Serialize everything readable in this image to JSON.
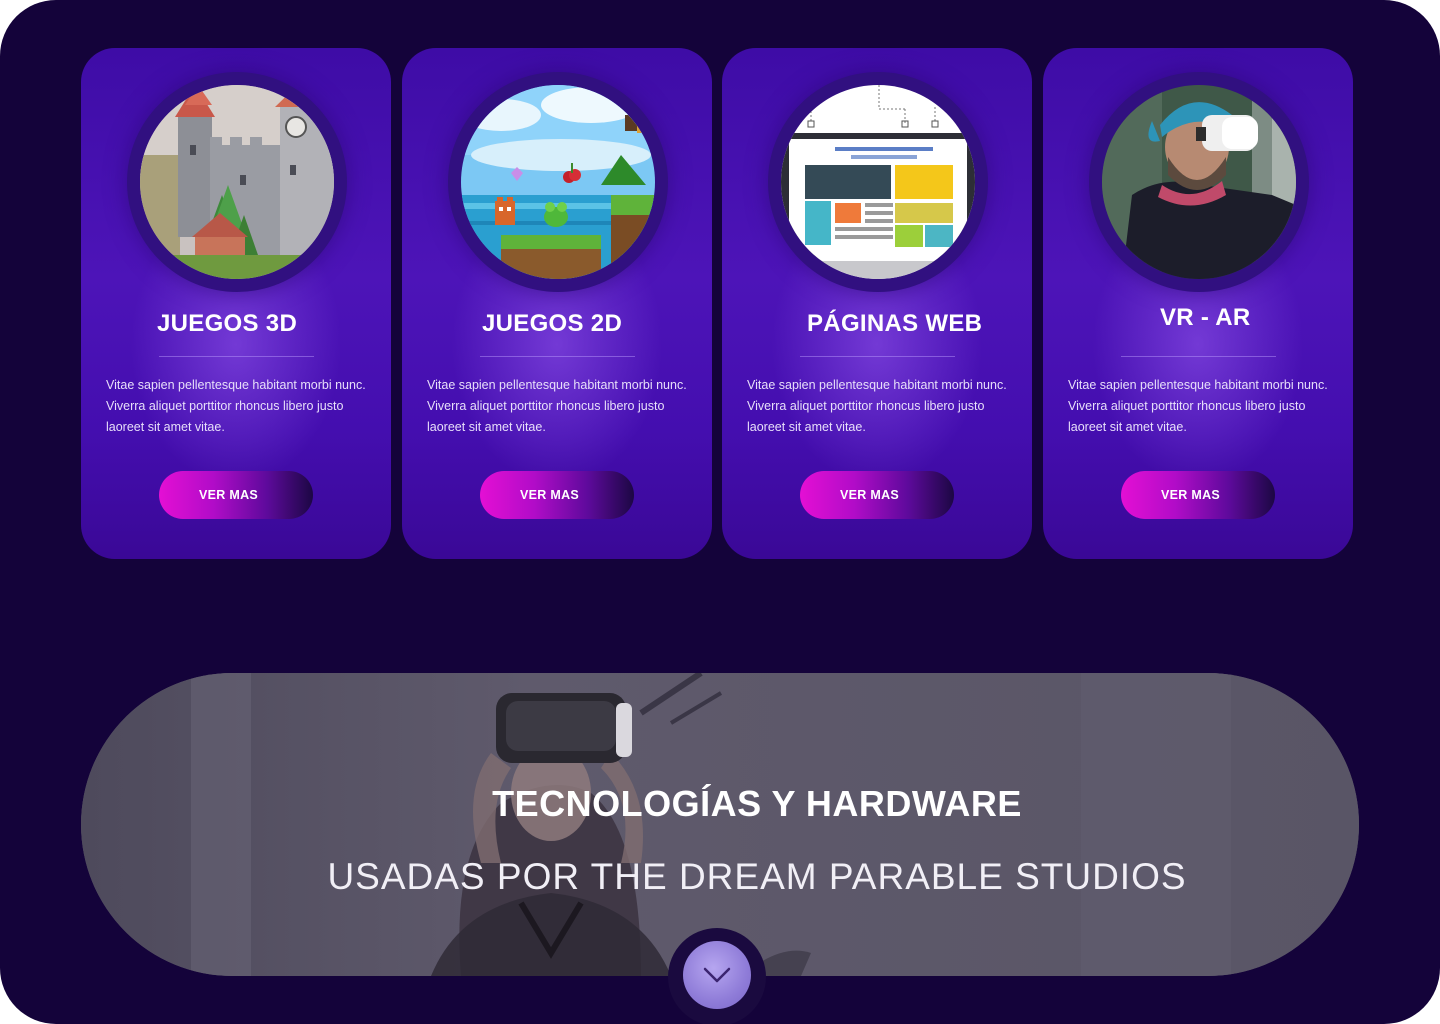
{
  "cards": [
    {
      "title": "JUEGOS 3D",
      "text": "Vitae sapien pellentesque habitant morbi nunc. Viverra aliquet  porttitor rhoncus libero justo laoreet sit amet vitae.",
      "button": "VER MAS",
      "image": "castle-3d-illustration"
    },
    {
      "title": "JUEGOS 2D",
      "text": "Vitae sapien pellentesque habitant morbi nunc. Viverra aliquet  porttitor rhoncus libero justo laoreet sit amet vitae.",
      "button": "VER MAS",
      "image": "pixel-platformer-illustration"
    },
    {
      "title": "PÁGINAS WEB",
      "text": "Vitae sapien pellentesque habitant morbi nunc. Viverra aliquet  porttitor rhoncus libero justo laoreet sit amet vitae.",
      "button": "VER MAS",
      "image": "website-wireframe-illustration"
    },
    {
      "title": "VR - AR",
      "text": "Vitae sapien pellentesque habitant morbi nunc. Viverra aliquet  porttitor rhoncus libero justo laoreet sit amet vitae.",
      "button": "VER MAS",
      "image": "man-with-vr-headset-photo"
    }
  ],
  "banner": {
    "title": "TECNOLOGÍAS Y HARDWARE",
    "subtitle": "USADAS  POR THE DREAM PARABLE STUDIOS",
    "image": "woman-with-vr-headset-photo"
  },
  "scroll_button": {
    "icon": "chevron-down-icon"
  },
  "colors": {
    "background": "#14033a",
    "card": "#4a12b4",
    "button_start": "#e40fd4",
    "button_end": "#1c0744",
    "scroll_button": "#9c8ae0"
  }
}
